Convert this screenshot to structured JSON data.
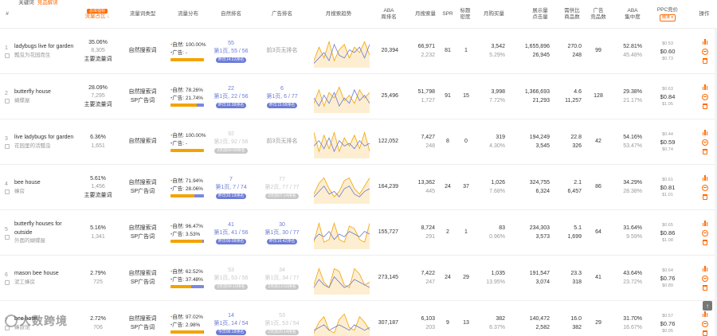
{
  "headers": {
    "idx": "#",
    "keyword": "关键词",
    "keyword_sub": "竞品解读",
    "traffic_badge": "总体指标",
    "traffic": "流量占比",
    "word_type": "流量词类型",
    "distribution": "流量分布",
    "natural_rank": "自然排名",
    "ad_rank": "广告排名",
    "trend": "月搜索趋势",
    "aba": "ABA\n周排名",
    "monthly": "月搜索量",
    "spr": "SPR",
    "title_density": "标题\n密度",
    "monthly_buy": "月购买量",
    "impression": "展示量\n点击量",
    "supply": "需供比\n商品数",
    "ad_products": "广告\n竞品数",
    "aba_conc": "ABA\n集中度",
    "ppc": "PPC竞价",
    "ppc_select": "精准 ▾",
    "ops": "操作"
  },
  "rows": [
    {
      "idx": "1",
      "kw": "ladybugs live for garden",
      "kw_cn": "瓢虫为花园而生",
      "share": "35.06%",
      "share_count": "8,305",
      "share_tag": "主要流量词",
      "type1": "自然搜索词",
      "type2": "",
      "nat_pct": "100.00%",
      "ad_pct": "-",
      "nat_ratio": 1.0,
      "nr_top": "55",
      "nr_mid": "第1页, 55 / 56",
      "nr_tag": "昨日14:22排名",
      "nr_faded": false,
      "ar_text": "前3页无排名",
      "ar_top": "",
      "ar_mid": "",
      "ar_tag": "",
      "ar_faded": false,
      "aba": "20,394",
      "monthly1": "66,971",
      "monthly2": "2,232",
      "spr": "81",
      "density": "1",
      "buy1": "3,542",
      "buy2": "5.29%",
      "imp1": "1,655,896",
      "imp2": "26,945",
      "sup1": "270.0",
      "sup2": "248",
      "adp": "99",
      "conc1": "52.81%",
      "conc2": "45.48%",
      "ppc1": "$0.53",
      "ppc2": "$0.60",
      "ppc3": "$0.73",
      "trend": [
        [
          0.2,
          0.7,
          0.3,
          0.9,
          0.2,
          0.6,
          0.8,
          0.3,
          0.7,
          0.5,
          0.9,
          0.4
        ],
        [
          0.1,
          0.3,
          0.5,
          0.2,
          0.8,
          0.4,
          0.3,
          0.6,
          0.5,
          0.7,
          0.3,
          0.8
        ]
      ]
    },
    {
      "idx": "2",
      "kw": "butterfly house",
      "kw_cn": "蝴蝶屋",
      "share": "28.09%",
      "share_count": "7,295",
      "share_tag": "主要流量词",
      "type1": "自然搜索词",
      "type2": "SP广告词",
      "nat_pct": "78.26%",
      "ad_pct": "21.74%",
      "nat_ratio": 0.78,
      "nr_top": "22",
      "nr_mid": "第1页, 22 / 56",
      "nr_tag": "昨日16:38排名",
      "nr_faded": false,
      "ar_text": "",
      "ar_top": "6",
      "ar_mid": "第1页, 6 / 77",
      "ar_tag": "昨日15:08排名",
      "ar_faded": false,
      "aba": "25,496",
      "monthly1": "51,798",
      "monthly2": "1,727",
      "spr": "91",
      "density": "15",
      "buy1": "3,998",
      "buy2": "7.72%",
      "imp1": "1,366,693",
      "imp2": "21,293",
      "sup1": "4.6",
      "sup2": "11,257",
      "adp": "128",
      "conc1": "29.38%",
      "conc2": "21.17%",
      "ppc1": "$0.63",
      "ppc2": "$0.84",
      "ppc3": "$1.05",
      "trend": [
        [
          0.3,
          0.8,
          0.2,
          0.7,
          0.5,
          0.9,
          0.4,
          0.6,
          0.3,
          0.8,
          0.5,
          0.7
        ],
        [
          0.5,
          0.2,
          0.6,
          0.3,
          0.7,
          0.2,
          0.5,
          0.3,
          0.8,
          0.4,
          0.6,
          0.3
        ]
      ]
    },
    {
      "idx": "3",
      "kw": "live ladybugs for garden",
      "kw_cn": "花园里的活瓢虫",
      "share": "6.36%",
      "share_count": "1,651",
      "share_tag": "",
      "type1": "自然搜索词",
      "type2": "",
      "nat_pct": "100.00%",
      "ad_pct": "-",
      "nat_ratio": 1.0,
      "nr_top": "92",
      "nr_mid": "第2页, 92 / 56",
      "nr_tag": "3天前09:09排名",
      "nr_faded": true,
      "ar_text": "前3页无排名",
      "ar_top": "",
      "ar_mid": "",
      "ar_tag": "",
      "ar_faded": false,
      "aba": "122,052",
      "monthly1": "7,427",
      "monthly2": "248",
      "spr": "8",
      "density": "0",
      "buy1": "319",
      "buy2": "4.30%",
      "imp1": "194,249",
      "imp2": "3,545",
      "sup1": "22.8",
      "sup2": "326",
      "adp": "42",
      "conc1": "54.16%",
      "conc2": "53.47%",
      "ppc1": "$0.44",
      "ppc2": "$0.59",
      "ppc3": "$0.74",
      "trend": [
        [
          0.9,
          0.2,
          0.8,
          0.3,
          0.9,
          0.2,
          0.7,
          0.4,
          0.8,
          0.3,
          0.9,
          0.2
        ],
        [
          0.4,
          0.6,
          0.3,
          0.7,
          0.2,
          0.6,
          0.4,
          0.5,
          0.3,
          0.6,
          0.4,
          0.5
        ]
      ]
    },
    {
      "idx": "4",
      "kw": "bee house",
      "kw_cn": "蜂房",
      "share": "5.61%",
      "share_count": "1,456",
      "share_tag": "主要流量词",
      "type1": "自然搜索词",
      "type2": "SP广告词",
      "nat_pct": "71.94%",
      "ad_pct": "28.06%",
      "nat_ratio": 0.72,
      "nr_top": "7",
      "nr_mid": "第1页, 7 / 74",
      "nr_tag": "昨日20:19排名",
      "nr_faded": false,
      "ar_text": "",
      "ar_top": "77",
      "ar_mid": "第2页, 77 / 77",
      "ar_tag": "3天前07:14排名",
      "ar_faded": true,
      "aba": "164,239",
      "monthly1": "13,362",
      "monthly2": "445",
      "spr": "24",
      "density": "37",
      "buy1": "1,026",
      "buy2": "7.68%",
      "imp1": "324,755",
      "imp2": "6,324",
      "sup1": "2.1",
      "sup2": "6,457",
      "adp": "86",
      "conc1": "34.29%",
      "conc2": "28.38%",
      "ppc1": "$0.61",
      "ppc2": "$0.81",
      "ppc3": "$1.01",
      "trend": [
        [
          0.3,
          0.7,
          0.9,
          0.5,
          0.2,
          0.4,
          0.8,
          0.9,
          0.5,
          0.3,
          0.6,
          0.9
        ],
        [
          0.2,
          0.4,
          0.6,
          0.3,
          0.4,
          0.2,
          0.5,
          0.6,
          0.3,
          0.2,
          0.4,
          0.5
        ]
      ]
    },
    {
      "idx": "5",
      "kw": "butterfly houses for outside",
      "kw_cn": "外面的蝴蝶屋",
      "share": "5.16%",
      "share_count": "1,341",
      "share_tag": "",
      "type1": "自然搜索词",
      "type2": "SP广告词",
      "nat_pct": "96.47%",
      "ad_pct": "3.53%",
      "nat_ratio": 0.96,
      "nr_top": "41",
      "nr_mid": "第1页, 41 / 56",
      "nr_tag": "昨日06:08排名",
      "nr_faded": false,
      "ar_text": "",
      "ar_top": "30",
      "ar_mid": "第1页, 30 / 77",
      "ar_tag": "昨日16:42排名",
      "ar_faded": false,
      "aba": "155,727",
      "monthly1": "8,724",
      "monthly2": "291",
      "spr": "2",
      "density": "1",
      "buy1": "83",
      "buy2": "0.96%",
      "imp1": "234,303",
      "imp2": "3,573",
      "sup1": "5.1",
      "sup2": "1,699",
      "adp": "64",
      "conc1": "31.64%",
      "conc2": "9.59%",
      "ppc1": "$0.65",
      "ppc2": "$0.86",
      "ppc3": "$1.08",
      "trend": [
        [
          0.2,
          0.9,
          0.2,
          0.3,
          0.9,
          0.3,
          0.2,
          0.8,
          0.7,
          0.3,
          0.2,
          0.9
        ],
        [
          0.3,
          0.5,
          0.4,
          0.6,
          0.3,
          0.5,
          0.4,
          0.6,
          0.5,
          0.4,
          0.6,
          0.5
        ]
      ]
    },
    {
      "idx": "6",
      "kw": "mason bee house",
      "kw_cn": "泥工蜂房",
      "share": "2.79%",
      "share_count": "725",
      "share_tag": "",
      "type1": "自然搜索词",
      "type2": "SP广告词",
      "nat_pct": "62.52%",
      "ad_pct": "37.48%",
      "nat_ratio": 0.63,
      "nr_top": "53",
      "nr_mid": "第1页, 53 / 56",
      "nr_tag": "3天前09:10排名",
      "nr_faded": true,
      "ar_text": "",
      "ar_top": "34",
      "ar_mid": "第1页, 34 / 77",
      "ar_tag": "3天前13:53排名",
      "ar_faded": true,
      "aba": "273,145",
      "monthly1": "7,422",
      "monthly2": "247",
      "spr": "24",
      "density": "29",
      "buy1": "1,035",
      "buy2": "13.95%",
      "imp1": "191,547",
      "imp2": "3,074",
      "sup1": "23.3",
      "sup2": "318",
      "adp": "41",
      "conc1": "43.64%",
      "conc2": "23.72%",
      "ppc1": "$0.64",
      "ppc2": "$0.76",
      "ppc3": "$0.89",
      "trend": [
        [
          0.3,
          0.9,
          0.4,
          0.2,
          0.9,
          0.8,
          0.3,
          0.2,
          0.9,
          0.7,
          0.3,
          0.4
        ],
        [
          0.2,
          0.5,
          0.3,
          0.2,
          0.6,
          0.4,
          0.2,
          0.3,
          0.5,
          0.4,
          0.3,
          0.2
        ]
      ]
    },
    {
      "idx": "7",
      "kw": "bee hotel",
      "kw_cn": "蜂旅馆",
      "share": "2.72%",
      "share_count": "706",
      "share_tag": "",
      "type1": "自然搜索词",
      "type2": "SP广告词",
      "nat_pct": "97.02%",
      "ad_pct": "2.98%",
      "nat_ratio": 0.97,
      "nr_top": "14",
      "nr_mid": "第1页, 14 / 54",
      "nr_tag": "今日06:18排名",
      "nr_faded": false,
      "ar_text": "",
      "ar_top": "53",
      "ar_mid": "第1页, 53 / 54",
      "ar_tag": "2天前20:14排名",
      "ar_faded": true,
      "aba": "307,187",
      "monthly1": "6,103",
      "monthly2": "203",
      "spr": "9",
      "density": "13",
      "buy1": "382",
      "buy2": "6.37%",
      "imp1": "140,472",
      "imp2": "2,582",
      "sup1": "16.0",
      "sup2": "382",
      "adp": "29",
      "conc1": "31.70%",
      "conc2": "16.67%",
      "ppc1": "$0.57",
      "ppc2": "$0.76",
      "ppc3": "$0.95",
      "trend": [
        [
          0.2,
          0.6,
          0.8,
          0.3,
          0.2,
          0.7,
          0.9,
          0.4,
          0.3,
          0.8,
          0.6,
          0.3
        ],
        [
          0.3,
          0.4,
          0.5,
          0.3,
          0.4,
          0.5,
          0.4,
          0.3,
          0.5,
          0.4,
          0.3,
          0.4
        ]
      ]
    }
  ],
  "watermark": "大数跨境",
  "scroll_top_icon": "arrow-up-icon"
}
